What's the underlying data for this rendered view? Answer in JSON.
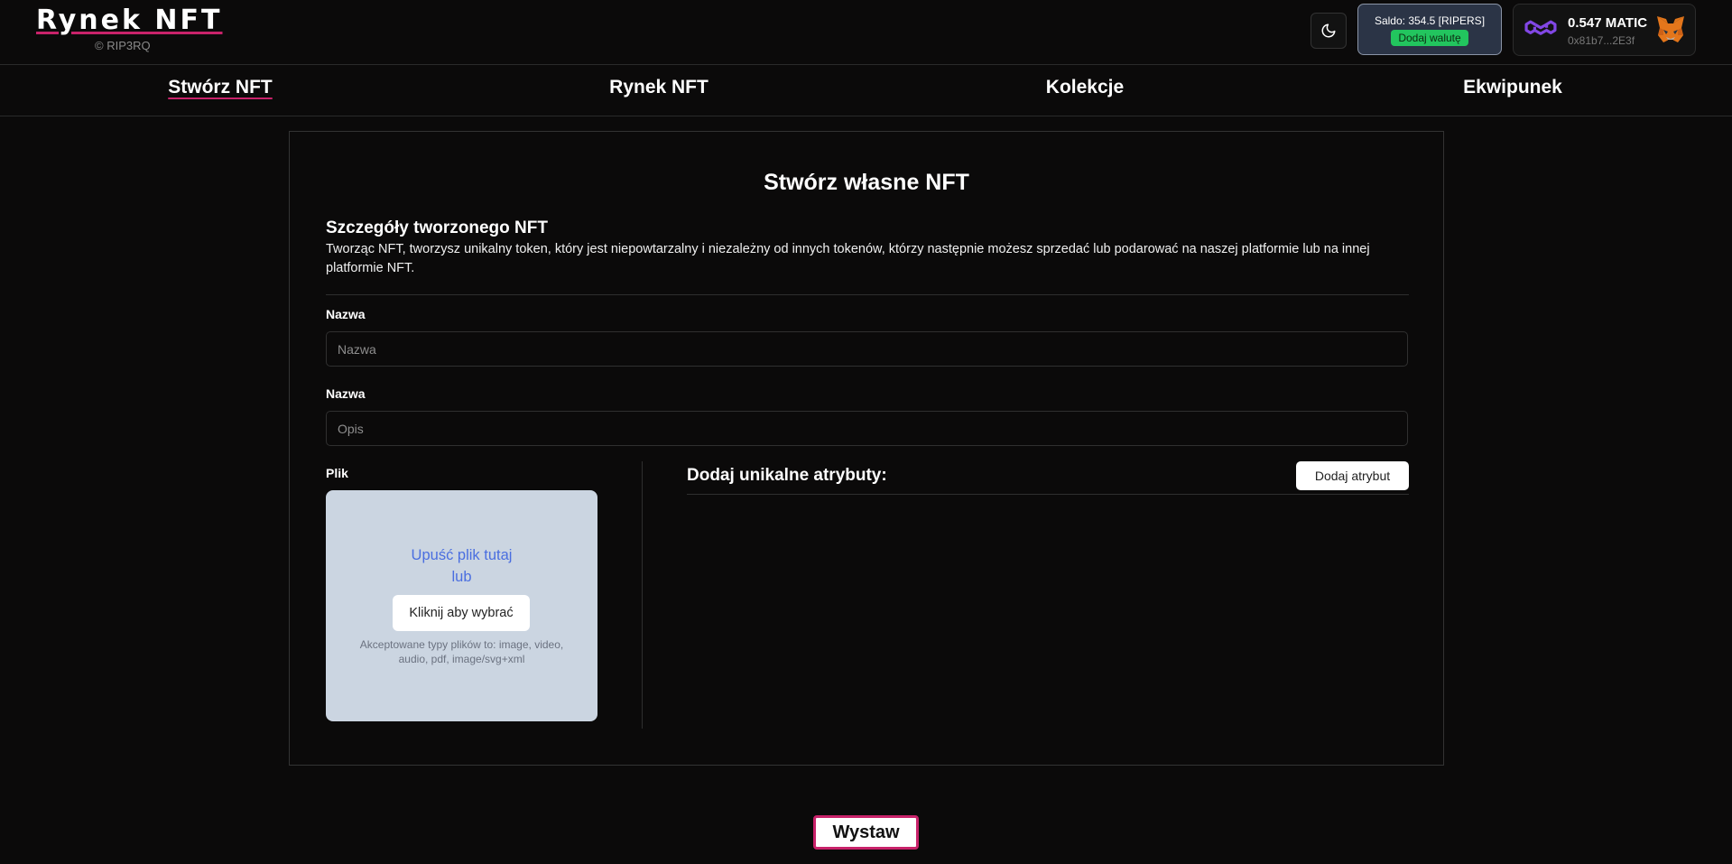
{
  "header": {
    "logo": "Rynek NFT",
    "copyright": "© RIP3RQ",
    "balance_text": "Saldo: 354.5 [RIPERS]",
    "add_currency_label": "Dodaj walutę",
    "matic_amount": "0.547 MATIC",
    "wallet_address": "0x81b7...2E3f"
  },
  "nav": {
    "items": [
      {
        "label": "Stwórz NFT",
        "active": true
      },
      {
        "label": "Rynek NFT",
        "active": false
      },
      {
        "label": "Kolekcje",
        "active": false
      },
      {
        "label": "Ekwipunek",
        "active": false
      }
    ]
  },
  "form": {
    "title": "Stwórz własne NFT",
    "section_heading": "Szczegóły tworzonego NFT",
    "section_description": "Tworząc NFT, tworzysz unikalny token, który jest niepowtarzalny i niezależny od innych tokenów, którzy następnie możesz sprzedać lub podarować na naszej platformie lub na innej platformie NFT.",
    "name_label": "Nazwa",
    "name_placeholder": "Nazwa",
    "description_label": "Nazwa",
    "description_placeholder": "Opis",
    "file_label": "Plik",
    "drop_text": "Upuść plik tutaj lub",
    "choose_file_label": "Kliknij aby wybrać",
    "accepted_types": "Akceptowane typy plików to: image, video, audio, pdf, image/svg+xml",
    "attributes_heading": "Dodaj unikalne atrybuty:",
    "add_attribute_label": "Dodaj atrybut",
    "submit_label": "Wystaw"
  },
  "colors": {
    "accent": "#c8226a",
    "background": "#0b0a0a",
    "balance_bg": "#2b3446",
    "success": "#22c55e",
    "dropzone_bg": "#cbd5e1",
    "link_blue": "#4a6ee0",
    "polygon_purple": "#8247e5"
  },
  "icons": {
    "theme": "moon-icon",
    "chain": "polygon-icon",
    "wallet": "metamask-fox-icon"
  }
}
